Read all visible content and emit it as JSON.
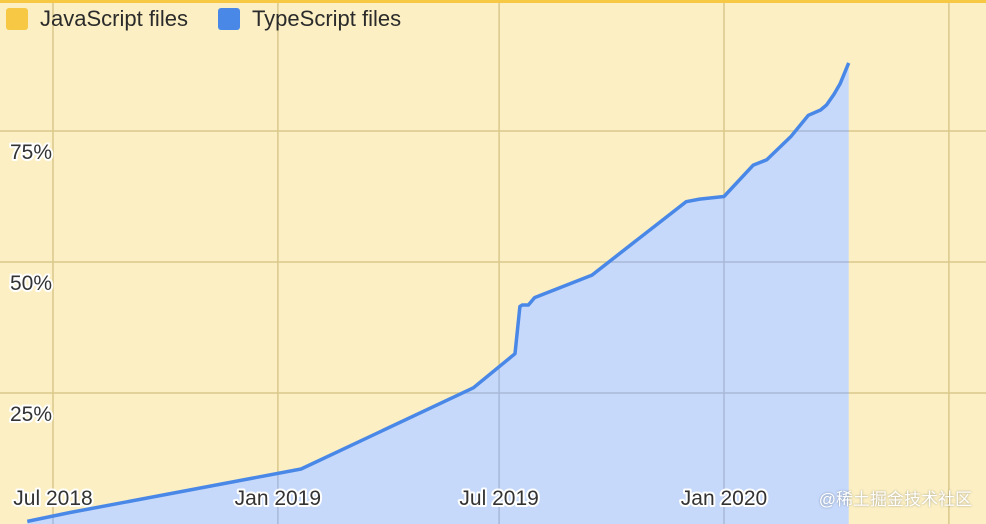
{
  "chart_data": {
    "type": "area",
    "title": "",
    "xlabel": "",
    "ylabel": "",
    "ylim": [
      0,
      100
    ],
    "yticks": [
      25,
      50,
      75
    ],
    "ytick_labels": [
      "25%",
      "50%",
      "75%"
    ],
    "xticks": [
      "2018-07-01",
      "2019-01-01",
      "2019-07-01",
      "2020-01-01"
    ],
    "xtick_labels": [
      "Jul 2018",
      "Jan 2019",
      "Jul 2019",
      "Jan 2020"
    ],
    "xlim": [
      "2018-06-10",
      "2020-03-31"
    ],
    "grid": true,
    "legend_position": "top-left",
    "series": [
      {
        "name": "JavaScript files",
        "color": "#f6c843",
        "fill": "#fbefc3",
        "values": "complement of TypeScript files (100% stacked)"
      },
      {
        "name": "TypeScript files",
        "color": "#4a88e8",
        "fill": "#c6d9fb",
        "points": [
          {
            "x": "2018-06-10",
            "y": 0.5
          },
          {
            "x": "2018-07-15",
            "y": 2.2
          },
          {
            "x": "2019-01-20",
            "y": 10.5
          },
          {
            "x": "2019-06-10",
            "y": 26.0
          },
          {
            "x": "2019-07-14",
            "y": 32.5
          },
          {
            "x": "2019-07-18",
            "y": 41.5
          },
          {
            "x": "2019-07-20",
            "y": 41.8
          },
          {
            "x": "2019-07-25",
            "y": 41.8
          },
          {
            "x": "2019-07-30",
            "y": 43.2
          },
          {
            "x": "2019-09-15",
            "y": 47.5
          },
          {
            "x": "2019-12-01",
            "y": 61.5
          },
          {
            "x": "2019-12-12",
            "y": 62.0
          },
          {
            "x": "2020-01-01",
            "y": 62.5
          },
          {
            "x": "2020-01-25",
            "y": 68.5
          },
          {
            "x": "2020-02-05",
            "y": 69.5
          },
          {
            "x": "2020-02-25",
            "y": 74.0
          },
          {
            "x": "2020-03-10",
            "y": 78.0
          },
          {
            "x": "2020-03-20",
            "y": 79.0
          },
          {
            "x": "2020-03-25",
            "y": 80.0
          },
          {
            "x": "2020-03-31",
            "y": 82.0
          },
          {
            "x": "2020-04-05",
            "y": 84.0
          },
          {
            "x": "2020-04-12",
            "y": 88.0
          }
        ]
      }
    ]
  },
  "legend": {
    "items": [
      {
        "label": "JavaScript files",
        "color": "#f6c843"
      },
      {
        "label": "TypeScript files",
        "color": "#4a88e8"
      }
    ]
  },
  "watermark": "@稀土掘金技术社区"
}
